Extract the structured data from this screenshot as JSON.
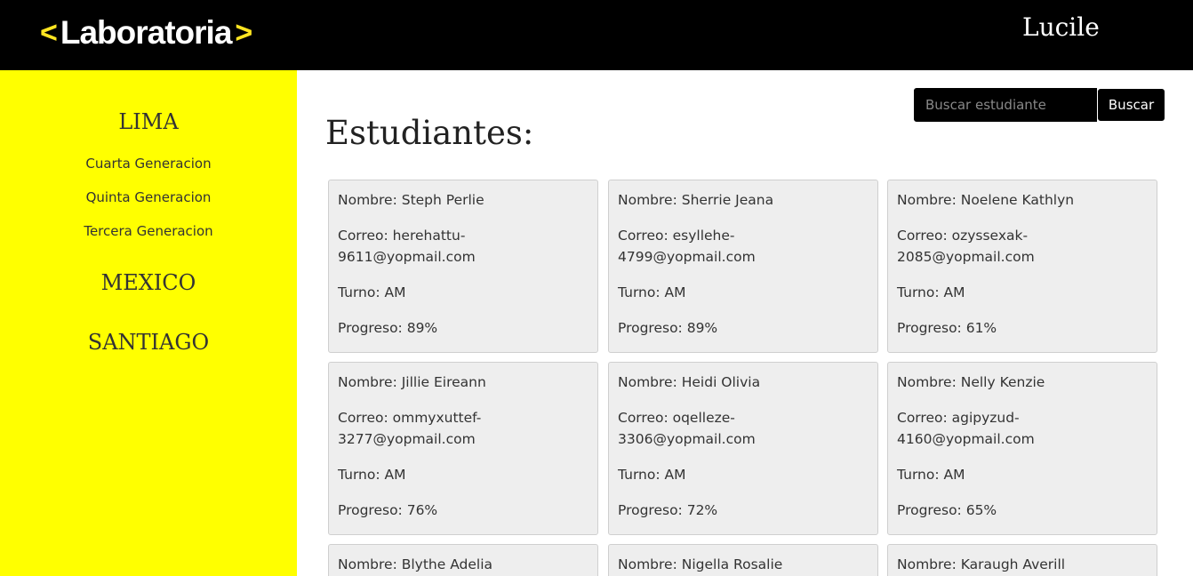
{
  "header": {
    "logo_text": "Laboratoria",
    "logo_left": "<",
    "logo_right": ">",
    "user_name": "Lucile",
    "bg_color": "#000000",
    "accent_color": "#ffe521"
  },
  "sidebar": {
    "bg_color": "#ffff00",
    "cities": [
      {
        "name": "LIMA",
        "generations": [
          "Cuarta Generacion",
          "Quinta Generacion",
          "Tercera Generacion"
        ]
      },
      {
        "name": "MEXICO",
        "generations": []
      },
      {
        "name": "SANTIAGO",
        "generations": []
      }
    ]
  },
  "search": {
    "placeholder": "Buscar estudiante",
    "value": "",
    "button_label": "Buscar"
  },
  "main": {
    "title": "Estudiantes:",
    "students": [
      {
        "nombre": "Nombre: Steph Perlie",
        "correo": "Correo: herehattu-9611@yopmail.com",
        "turno": "Turno: AM",
        "progreso": "Progreso: 89%"
      },
      {
        "nombre": "Nombre: Sherrie Jeana",
        "correo": "Correo: esyllehe-4799@yopmail.com",
        "turno": "Turno: AM",
        "progreso": "Progreso: 89%"
      },
      {
        "nombre": "Nombre: Noelene Kathlyn",
        "correo": "Correo: ozyssexak-2085@yopmail.com",
        "turno": "Turno: AM",
        "progreso": "Progreso: 61%"
      },
      {
        "nombre": "Nombre: Jillie Eireann",
        "correo": "Correo: ommyxuttef-3277@yopmail.com",
        "turno": "Turno: AM",
        "progreso": "Progreso: 76%"
      },
      {
        "nombre": "Nombre: Heidi Olivia",
        "correo": "Correo: oqelleze-3306@yopmail.com",
        "turno": "Turno: AM",
        "progreso": "Progreso: 72%"
      },
      {
        "nombre": "Nombre: Nelly Kenzie",
        "correo": "Correo: agipyzud-4160@yopmail.com",
        "turno": "Turno: AM",
        "progreso": "Progreso: 65%"
      },
      {
        "nombre": "Nombre: Blythe Adelia",
        "correo": "",
        "turno": "",
        "progreso": ""
      },
      {
        "nombre": "Nombre: Nigella Rosalie",
        "correo": "",
        "turno": "",
        "progreso": ""
      },
      {
        "nombre": "Nombre: Karaugh Averill",
        "correo": "",
        "turno": "",
        "progreso": ""
      }
    ]
  }
}
